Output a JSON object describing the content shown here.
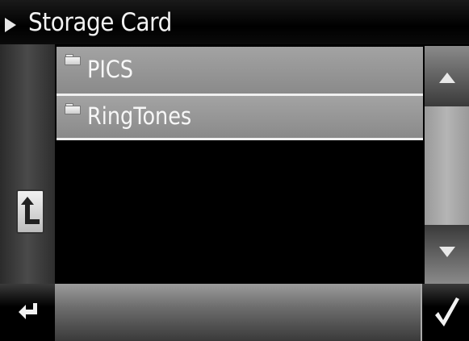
{
  "window": {
    "title": "Storage Card"
  },
  "file_list": {
    "items": [
      {
        "label": "PICS",
        "icon": "folder-icon"
      },
      {
        "label": "RingTones",
        "icon": "folder-icon"
      }
    ]
  },
  "navigation": {
    "up_icon": "up-folder-icon",
    "scroll_up_icon": "triangle-up-icon",
    "scroll_down_icon": "triangle-down-icon",
    "back_icon": "return-arrow-icon",
    "confirm_icon": "checkmark-icon"
  },
  "colors": {
    "background": "#000000",
    "item_background": "#969696",
    "text": "#f2f2f2"
  }
}
